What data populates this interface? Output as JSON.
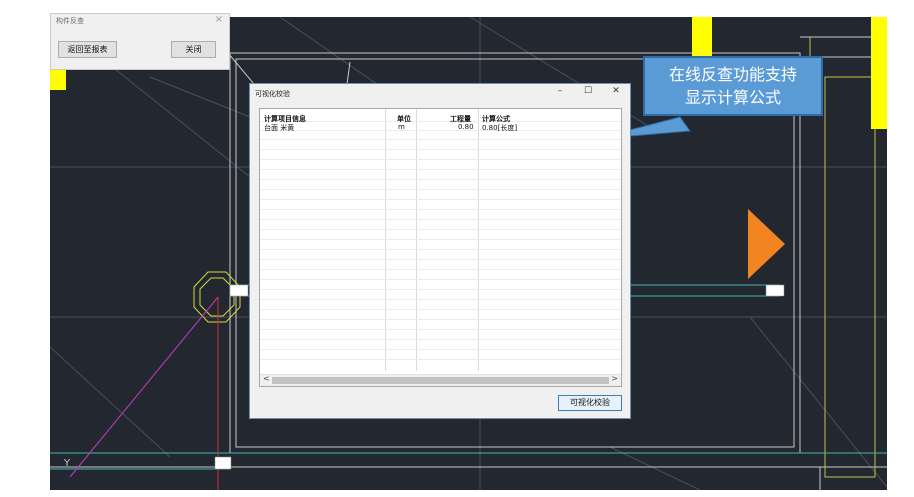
{
  "reverse_lookup_window": {
    "title": "构件反查",
    "close_glyph": "×",
    "back_to_report_label": "返回至报表",
    "close_label": "关闭"
  },
  "visual_check_dialog": {
    "title": "可视化校验",
    "minimize_glyph": "–",
    "maximize_glyph": "☐",
    "close_glyph": "✕",
    "columns": [
      "计算项目信息",
      "单位",
      "工程量",
      "计算公式"
    ],
    "rows": [
      {
        "item": "台面 米黄",
        "unit": "m",
        "quantity": "0.80",
        "formula": "0.80[长度]"
      }
    ],
    "scroll_left": "<",
    "scroll_right": ">",
    "check_button_label": "可视化校验"
  },
  "callout": {
    "line1": "在线反查功能支持",
    "line2": "显示计算公式"
  },
  "cad_labels": {
    "y_axis": "Y"
  },
  "colors": {
    "cad_background": "#232830",
    "callout_fill": "#5b9bd5",
    "marker_orange": "#f28522",
    "highlight_yellow": "#ffff00"
  }
}
